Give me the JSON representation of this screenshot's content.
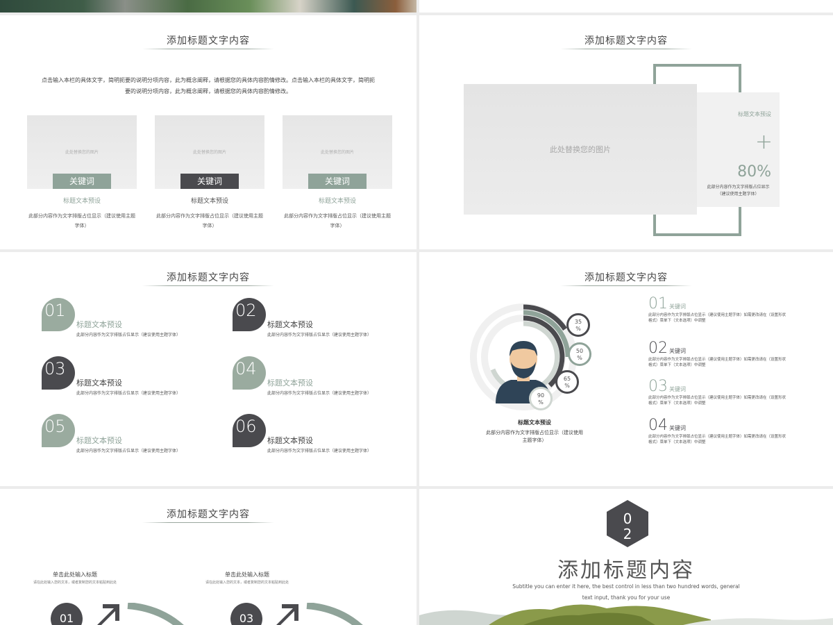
{
  "slide_title": "添加标题文字内容",
  "slide1": {
    "intro": "点击输入本栏的具体文字，简明扼要的说明分项内容，此为概念阐释，请根据您的具体内容酌情修改。点击输入本栏的具体文字，简明扼要的说明分项内容，此为概念阐释，请根据您的具体内容酌情修改。",
    "cards": [
      {
        "placeholder": "此处替换您的图片",
        "keyword": "关键词",
        "title": "标题文本预设",
        "desc": "此部分内容作为文字排版占位显示（建议使用主题字体）"
      },
      {
        "placeholder": "此处替换您的图片",
        "keyword": "关键词",
        "title": "标题文本预设",
        "desc": "此部分内容作为文字排版占位显示（建议使用主题字体）"
      },
      {
        "placeholder": "此处替换您的图片",
        "keyword": "关键词",
        "title": "标题文本预设",
        "desc": "此部分内容作为文字排版占位显示（建议使用主题字体）"
      }
    ]
  },
  "slide2": {
    "image_placeholder": "此处替换您的图片",
    "card_title": "标题文本预设",
    "plus": "+",
    "percent": "80%",
    "card_desc": "此部分内容作为文字排版占位显示（建议使用主题字体）"
  },
  "slide3": {
    "steps": [
      {
        "num": "01",
        "title": "标题文本预设",
        "desc": "此部分内容作为文字排版占位显示（建议使用主题字体）"
      },
      {
        "num": "02",
        "title": "标题文本预设",
        "desc": "此部分内容作为文字排版占位显示（建议使用主题字体）"
      },
      {
        "num": "03",
        "title": "标题文本预设",
        "desc": "此部分内容作为文字排版占位显示（建议使用主题字体）"
      },
      {
        "num": "04",
        "title": "标题文本预设",
        "desc": "此部分内容作为文字排版占位显示（建议使用主题字体）"
      },
      {
        "num": "05",
        "title": "标题文本预设",
        "desc": "此部分内容作为文字排版占位显示（建议使用主题字体）"
      },
      {
        "num": "06",
        "title": "标题文本预设",
        "desc": "此部分内容作为文字排版占位显示（建议使用主题字体）"
      }
    ]
  },
  "slide4": {
    "rings": [
      {
        "label": "35\n%",
        "value": 35
      },
      {
        "label": "50\n%",
        "value": 50
      },
      {
        "label": "65\n%",
        "value": 65
      },
      {
        "label": "90\n%",
        "value": 90
      }
    ],
    "avatar_title": "标题文本预设",
    "avatar_desc": "此部分内容作为文字排版占位显示（建议使用主题字体）",
    "items": [
      {
        "num": "01",
        "keyword": "关键词",
        "desc": "此部分内容作为文字排版占位显示（建议使用主题字体）如需更改请在（设置形状格式）菜单下（文本选项）中调整"
      },
      {
        "num": "02",
        "keyword": "关键词",
        "desc": "此部分内容作为文字排版占位显示（建议使用主题字体）如需更改请在（设置形状格式）菜单下（文本选项）中调整"
      },
      {
        "num": "03",
        "keyword": "关键词",
        "desc": "此部分内容作为文字排版占位显示（建议使用主题字体）如需更改请在（设置形状格式）菜单下（文本选项）中调整"
      },
      {
        "num": "04",
        "keyword": "关键词",
        "desc": "此部分内容作为文字排版占位显示（建议使用主题字体）如需更改请在（设置形状格式）菜单下（文本选项）中调整"
      }
    ]
  },
  "slide5": {
    "blocks": [
      {
        "title": "单击此处输入标题",
        "desc": "请在此处输入您的文本，或者复制您的文本粘贴到此处",
        "num": "01"
      },
      {
        "title": "单击此处输入标题",
        "desc": "请在此处输入您的文本，或者复制您的文本粘贴到此处",
        "num": "03"
      }
    ]
  },
  "slide6": {
    "section_num": "0\n2",
    "title": "添加标题内容",
    "subtitle": "Subtitle you can enter it here, the best control in less than two hundred words, general text input, thank you for your use"
  },
  "colors": {
    "accent": "#8fa399",
    "dark": "#4a4a4e"
  }
}
